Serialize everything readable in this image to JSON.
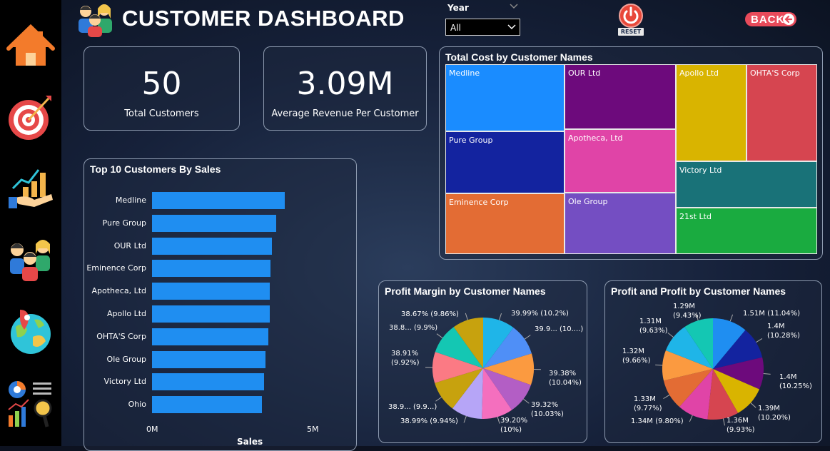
{
  "header": {
    "title": "CUSTOMER DASHBOARD"
  },
  "filters": {
    "year_label": "Year",
    "year_value": "All"
  },
  "controls": {
    "reset_label": "RESET",
    "back_label": "BACK"
  },
  "kpis": [
    {
      "value": "50",
      "label": "Total Customers"
    },
    {
      "value": "3.09M",
      "label": "Average Revenue Per Customer"
    }
  ],
  "sidebar": {
    "icons": [
      "home-icon",
      "target-icon",
      "growth-chart-hand-icon",
      "customers-icon",
      "globe-map-icon",
      "analytics-icon"
    ]
  },
  "colors": {
    "bar": "#1f8ef1",
    "accent_back": "#e84a5a",
    "reset": "#e8483a"
  },
  "top_customers": {
    "title": "Top 10 Customers By Sales",
    "xlabel": "Sales",
    "ticks": [
      "0M",
      "5M"
    ]
  },
  "treemap": {
    "title": "Total Cost by Customer Names",
    "cells": [
      {
        "name": "Medline",
        "color": "#1a8cff"
      },
      {
        "name": "Pure Group",
        "color": "#13239f"
      },
      {
        "name": "Eminence Corp",
        "color": "#e36c34"
      },
      {
        "name": "OUR Ltd",
        "color": "#6d0a7c"
      },
      {
        "name": "Apotheca, Ltd",
        "color": "#e044a7"
      },
      {
        "name": "Ole Group",
        "color": "#744ec2"
      },
      {
        "name": "Apollo Ltd",
        "color": "#d9b400"
      },
      {
        "name": "OHTA'S Corp",
        "color": "#d64550"
      },
      {
        "name": "Victory Ltd",
        "color": "#197278"
      },
      {
        "name": "21st Ltd",
        "color": "#1aab40"
      }
    ]
  },
  "profit_margin": {
    "title": "Profit Margin by Customer Names",
    "labels": [
      "39.99% (10.2%)",
      "39.9... (10....)",
      "39.38%\n(10.04%)",
      "39.32%\n(10.03%)",
      "39.20%\n(10%)",
      "38.99% (9.94%)",
      "38.9... (9.9...)",
      "38.91%\n(9.92%)",
      "38.8... (9.9%)",
      "38.67% (9.86%)"
    ]
  },
  "profit": {
    "title": "Profit and Profit by Customer Names",
    "labels": [
      "1.51M (11.04%)",
      "1.4M\n(10.28%)",
      "1.4M\n(10.25%)",
      "1.39M\n(10.20%)",
      "1.36M\n(9.93%)",
      "1.34M (9.80%)",
      "1.33M\n(9.77%)",
      "1.32M\n(9.66%)",
      "1.31M\n(9.63%)",
      "1.29M\n(9.43%)"
    ]
  },
  "chart_data": [
    {
      "type": "bar",
      "orientation": "horizontal",
      "title": "Top 10 Customers By Sales",
      "xlabel": "Sales",
      "ylabel": "",
      "categories": [
        "Medline",
        "Pure Group",
        "OUR Ltd",
        "Eminence Corp",
        "Apotheca, Ltd",
        "Apollo Ltd",
        "OHTA'S Corp",
        "Ole Group",
        "Victory Ltd",
        "Ohio"
      ],
      "values": [
        4.1,
        3.83,
        3.7,
        3.66,
        3.64,
        3.64,
        3.6,
        3.5,
        3.45,
        3.4
      ],
      "unit": "M",
      "xlim": [
        0,
        5.5
      ],
      "grid": false
    },
    {
      "type": "treemap",
      "title": "Total Cost by Customer Names",
      "categories": [
        "Medline",
        "Pure Group",
        "Eminence Corp",
        "OUR Ltd",
        "Apotheca, Ltd",
        "Ole Group",
        "Apollo Ltd",
        "OHTA'S Corp",
        "Victory Ltd",
        "21st Ltd"
      ],
      "values": [
        1.0,
        0.96,
        0.93,
        0.95,
        0.93,
        0.91,
        0.9,
        0.89,
        0.89,
        0.89
      ]
    },
    {
      "type": "pie",
      "title": "Profit Margin by Customer Names",
      "values": [
        10.2,
        10.1,
        10.04,
        10.03,
        10.0,
        9.94,
        9.9,
        9.92,
        9.9,
        9.86
      ],
      "colors": [
        "#1fb5e8",
        "#4f8ff7",
        "#fb9a40",
        "#b35ec5",
        "#f46fbe",
        "#b6a5f7",
        "#c7a20e",
        "#fb7a84",
        "#14c7b3",
        "#c7a20e"
      ]
    },
    {
      "type": "pie",
      "title": "Profit and Profit by Customer Names",
      "values": [
        1.51,
        1.4,
        1.4,
        1.39,
        1.36,
        1.34,
        1.33,
        1.32,
        1.31,
        1.29
      ],
      "colors": [
        "#1f8ef1",
        "#13239f",
        "#6d0a7c",
        "#d9b400",
        "#d64550",
        "#e044a7",
        "#e36c34",
        "#fb9a40",
        "#1fb5e8",
        "#14c7b3"
      ]
    }
  ]
}
